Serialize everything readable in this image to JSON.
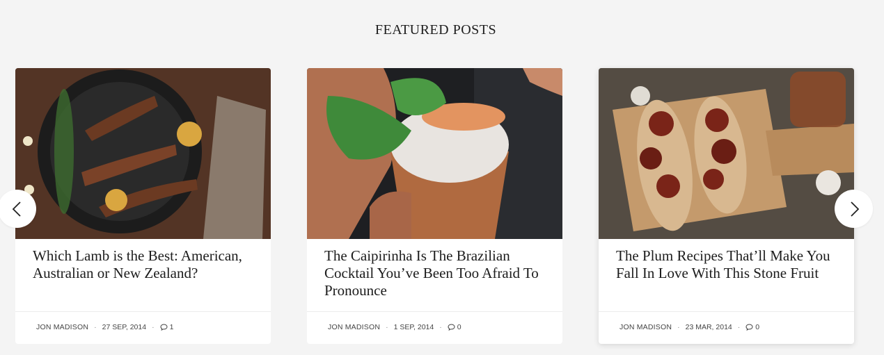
{
  "section": {
    "title": "FEATURED POSTS"
  },
  "nav": {
    "prev_icon": "chevron-left-icon",
    "next_icon": "chevron-right-icon"
  },
  "posts": [
    {
      "title": "Which Lamb is the Best: American, Australian or New Zealand?",
      "author": "JON MADISON",
      "date": "27 SEP, 2014",
      "comments": "1",
      "image": "grilled-lamb-chops-in-cast-iron-pan"
    },
    {
      "title": "The Caipirinha Is The Brazilian Cocktail You’ve Been Too Afraid To Pronounce",
      "author": "JON MADISON",
      "date": "1 SEP, 2014",
      "comments": "0",
      "image": "copper-cup-cocktail-with-mint"
    },
    {
      "title": "The Plum Recipes That’ll Make You Fall In Love With This Stone Fruit",
      "author": "JON MADISON",
      "date": "23 MAR, 2014",
      "comments": "0",
      "image": "sun-dried-tomato-bruschetta-on-board"
    }
  ],
  "colors": {
    "background": "#f4f4f4",
    "card": "#ffffff",
    "text": "#1c1c1c"
  }
}
